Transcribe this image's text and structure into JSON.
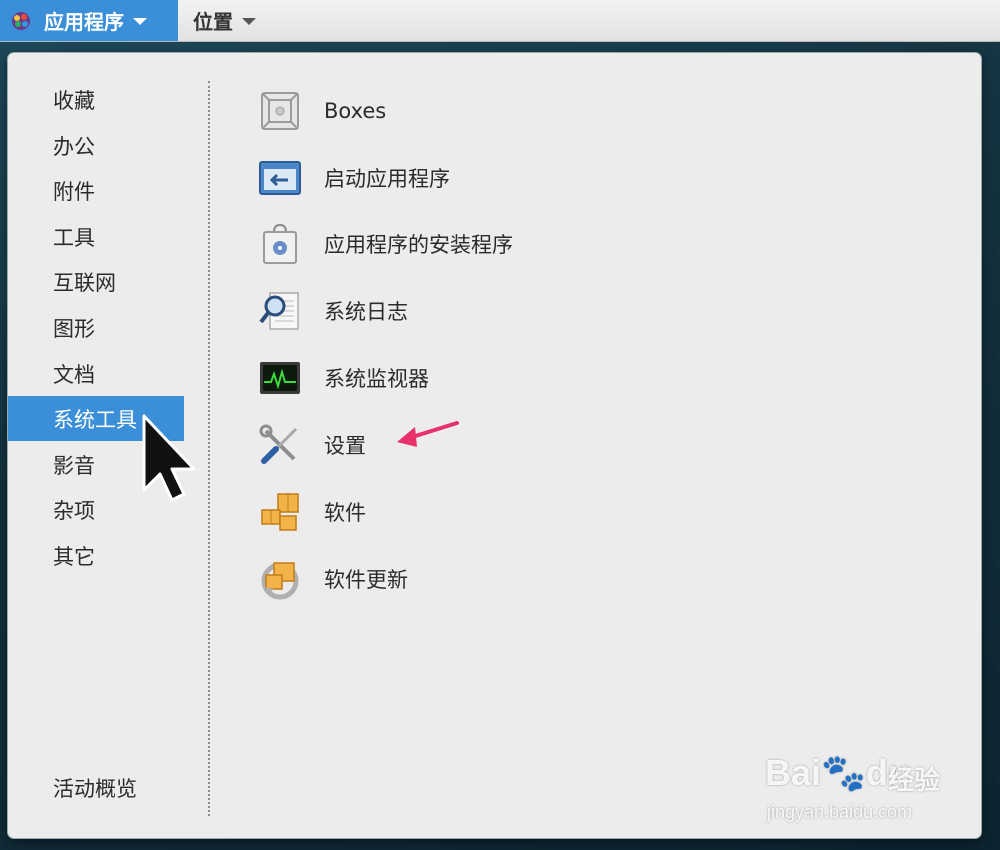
{
  "topbar": {
    "applications_label": "应用程序",
    "places_label": "位置"
  },
  "categories": [
    {
      "label": "收藏",
      "selected": false
    },
    {
      "label": "办公",
      "selected": false
    },
    {
      "label": "附件",
      "selected": false
    },
    {
      "label": "工具",
      "selected": false
    },
    {
      "label": "互联网",
      "selected": false
    },
    {
      "label": "图形",
      "selected": false
    },
    {
      "label": "文档",
      "selected": false
    },
    {
      "label": "系统工具",
      "selected": true
    },
    {
      "label": "影音",
      "selected": false
    },
    {
      "label": "杂项",
      "selected": false
    },
    {
      "label": "其它",
      "selected": false
    }
  ],
  "activities_label": "活动概览",
  "apps": [
    {
      "label": "Boxes",
      "icon": "boxes-icon"
    },
    {
      "label": "启动应用程序",
      "icon": "startup-apps-icon"
    },
    {
      "label": "应用程序的安装程序",
      "icon": "software-installer-icon"
    },
    {
      "label": "系统日志",
      "icon": "system-log-icon"
    },
    {
      "label": "系统监视器",
      "icon": "system-monitor-icon"
    },
    {
      "label": "设置",
      "icon": "settings-tools-icon"
    },
    {
      "label": "软件",
      "icon": "software-packages-icon"
    },
    {
      "label": "软件更新",
      "icon": "software-update-icon"
    }
  ],
  "watermark": {
    "brand_text": "Bai",
    "brand_suffix": "du",
    "brand_cn": "经验",
    "url": "jingyan.baidu.com"
  },
  "colors": {
    "accent": "#3a8fd8",
    "annotation_arrow": "#e8306a"
  }
}
